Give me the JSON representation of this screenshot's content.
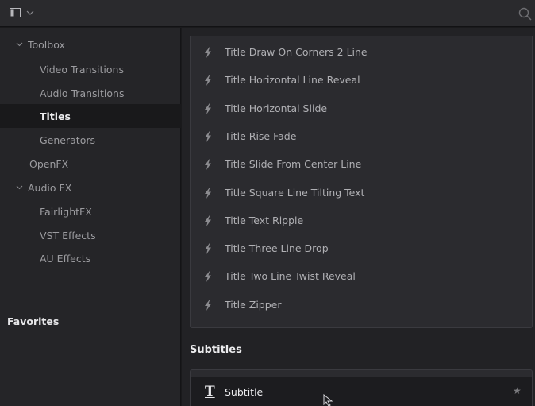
{
  "toolbar": {
    "panel_toggle_icon": "sidebar-panel-icon",
    "dropdown_icon": "chevron-down-icon",
    "search_icon": "search-icon"
  },
  "sidebar": {
    "items": [
      {
        "label": "Toolbox",
        "expanded": true,
        "selected": false
      },
      {
        "label": "Video Transitions",
        "selected": false
      },
      {
        "label": "Audio Transitions",
        "selected": false
      },
      {
        "label": "Titles",
        "selected": true
      },
      {
        "label": "Generators",
        "selected": false
      },
      {
        "label": "OpenFX",
        "selected": false
      },
      {
        "label": "Audio FX",
        "expanded": true,
        "selected": false
      },
      {
        "label": "FairlightFX",
        "selected": false
      },
      {
        "label": "VST Effects",
        "selected": false
      },
      {
        "label": "AU Effects",
        "selected": false
      }
    ],
    "favorites_label": "Favorites"
  },
  "titles": {
    "item_icon": "lightning-bolt-icon",
    "items": [
      "Title Draw On Corners 2 Line",
      "Title Horizontal Line Reveal",
      "Title Horizontal Slide",
      "Title Rise Fade",
      "Title Slide From Center Line",
      "Title Square Line Tilting Text",
      "Title Text Ripple",
      "Title Three Line Drop",
      "Title Two Line Twist Reveal",
      "Title Zipper"
    ]
  },
  "subtitles": {
    "section_title": "Subtitles",
    "item_label": "Subtitle",
    "item_icon": "text-t-icon",
    "favorite_icon": "star-icon"
  },
  "colors": {
    "background": "#1a1a1c",
    "sidebar_bg": "#252528",
    "selected_row_bg": "#19191b",
    "list_bg": "#2b2b2f"
  }
}
